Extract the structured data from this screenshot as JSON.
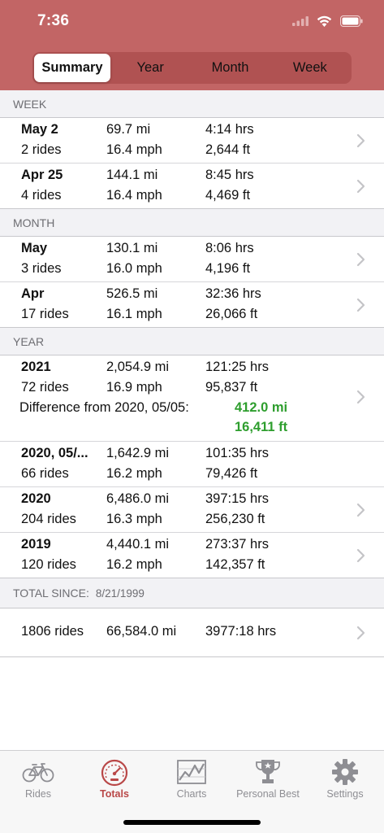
{
  "status": {
    "time": "7:36"
  },
  "segments": [
    {
      "label": "Summary",
      "active": true
    },
    {
      "label": "Year",
      "active": false
    },
    {
      "label": "Month",
      "active": false
    },
    {
      "label": "Week",
      "active": false
    }
  ],
  "week": {
    "heading": "WEEK",
    "rows": [
      {
        "period": "May 2",
        "rides": "2 rides",
        "distance": "69.7 mi",
        "speed": "16.4 mph",
        "time": "4:14 hrs",
        "climb": "2,644 ft"
      },
      {
        "period": "Apr 25",
        "rides": "4 rides",
        "distance": "144.1 mi",
        "speed": "16.4 mph",
        "time": "8:45 hrs",
        "climb": "4,469 ft"
      }
    ]
  },
  "month": {
    "heading": "MONTH",
    "rows": [
      {
        "period": "May",
        "rides": "3 rides",
        "distance": "130.1 mi",
        "speed": "16.0 mph",
        "time": "8:06 hrs",
        "climb": "4,196 ft"
      },
      {
        "period": "Apr",
        "rides": "17 rides",
        "distance": "526.5 mi",
        "speed": "16.1 mph",
        "time": "32:36 hrs",
        "climb": "26,066 ft"
      }
    ]
  },
  "year": {
    "heading": "YEAR",
    "current": {
      "period": "2021",
      "rides": "72 rides",
      "distance": "2,054.9 mi",
      "speed": "16.9 mph",
      "time": "121:25 hrs",
      "climb": "95,837 ft",
      "difference_label": "Difference from 2020, 05/05:",
      "difference_distance": "412.0 mi",
      "difference_climb": "16,411 ft"
    },
    "rows": [
      {
        "period": "2020, 05/...",
        "rides": "66 rides",
        "distance": "1,642.9 mi",
        "speed": "16.2 mph",
        "time": "101:35 hrs",
        "climb": "79,426 ft"
      },
      {
        "period": "2020",
        "rides": "204 rides",
        "distance": "6,486.0 mi",
        "speed": "16.3 mph",
        "time": "397:15 hrs",
        "climb": "256,230 ft"
      },
      {
        "period": "2019",
        "rides": "120 rides",
        "distance": "4,440.1 mi",
        "speed": "16.2 mph",
        "time": "273:37 hrs",
        "climb": "142,357 ft"
      }
    ]
  },
  "total": {
    "heading": "TOTAL SINCE:",
    "since_date": "8/21/1999",
    "rides": "1806 rides",
    "distance": "66,584.0 mi",
    "time": "3977:18 hrs"
  },
  "tabs": [
    {
      "label": "Rides",
      "icon": "bicycle-icon",
      "active": false
    },
    {
      "label": "Totals",
      "icon": "speedometer-icon",
      "active": true
    },
    {
      "label": "Charts",
      "icon": "line-chart-icon",
      "active": false
    },
    {
      "label": "Personal Best",
      "icon": "trophy-icon",
      "active": false
    },
    {
      "label": "Settings",
      "icon": "gear-icon",
      "active": false
    }
  ],
  "colors": {
    "header": "#c26565",
    "accent": "#b94848",
    "positive": "#2e9e2e"
  }
}
